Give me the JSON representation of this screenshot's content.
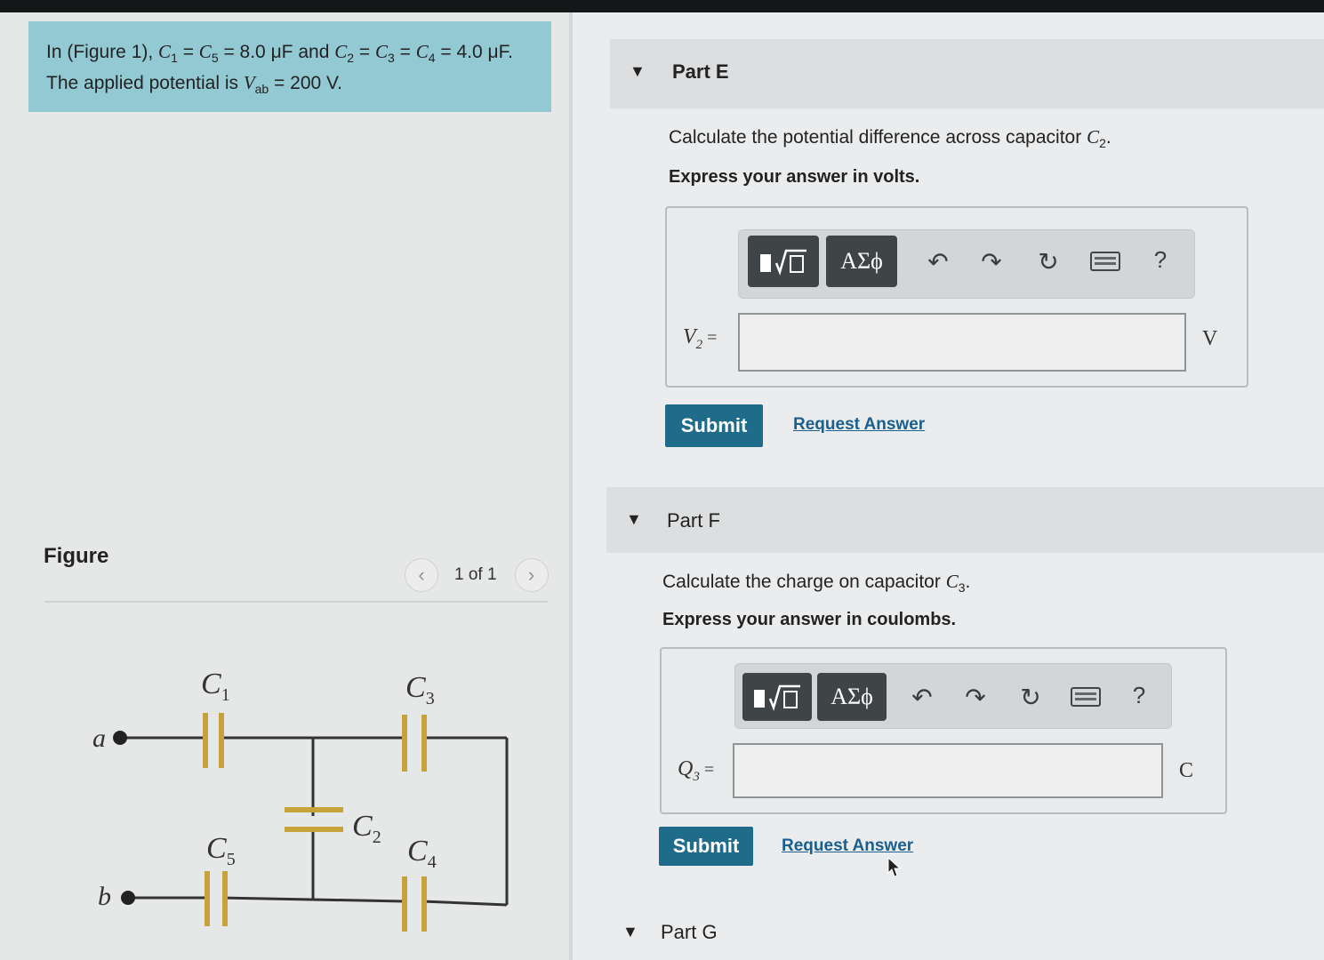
{
  "intro": {
    "prefix": "In (Figure 1), ",
    "c1": "C",
    "c1_sub": "1",
    "eq1": " = ",
    "c5": "C",
    "c5_sub": "5",
    "val1": " = 8.0 μF and ",
    "c2": "C",
    "c2_sub": "2",
    "eq2": " = ",
    "c3": "C",
    "c3_sub": "3",
    "eq3": " = ",
    "c4": "C",
    "c4_sub": "4",
    "val2": " = 4.0 μF. The applied potential is ",
    "v": "V",
    "v_sub": "ab",
    "val3": " = 200 V."
  },
  "figure": {
    "label": "Figure",
    "pager_text": "1 of 1",
    "prev_glyph": "‹",
    "next_glyph": "›",
    "circuit": {
      "node_a": "a",
      "node_b": "b",
      "c1": "C",
      "c1_sub": "1",
      "c2": "C",
      "c2_sub": "2",
      "c3": "C",
      "c3_sub": "3",
      "c4": "C",
      "c4_sub": "4",
      "c5": "C",
      "c5_sub": "5"
    }
  },
  "partE": {
    "title": "Part E",
    "question_prefix": "Calculate the potential difference across capacitor ",
    "question_var": "C",
    "question_sub": "2",
    "question_suffix": ".",
    "instruction": "Express your answer in volts.",
    "toolbar": {
      "greek": "ΑΣϕ",
      "help": "?"
    },
    "input_label_var": "V",
    "input_label_sub": "2",
    "input_label_eq": " =",
    "input_value": "",
    "unit": "V",
    "submit": "Submit",
    "request": "Request Answer"
  },
  "partF": {
    "title": "Part F",
    "question_prefix": "Calculate the charge on capacitor ",
    "question_var": "C",
    "question_sub": "3",
    "question_suffix": ".",
    "instruction": "Express your answer in coulombs.",
    "toolbar": {
      "greek": "ΑΣϕ",
      "help": "?"
    },
    "input_label_var": "Q",
    "input_label_sub": "3",
    "input_label_eq": " =",
    "input_value": "",
    "unit": "C",
    "submit": "Submit",
    "request": "Request Answer"
  },
  "partG": {
    "title": "Part G"
  },
  "colors": {
    "intro_bg": "#93c9d3",
    "submit_bg": "#1f6b8a",
    "link": "#1a5f8e",
    "capacitor": "#c8a23a"
  }
}
